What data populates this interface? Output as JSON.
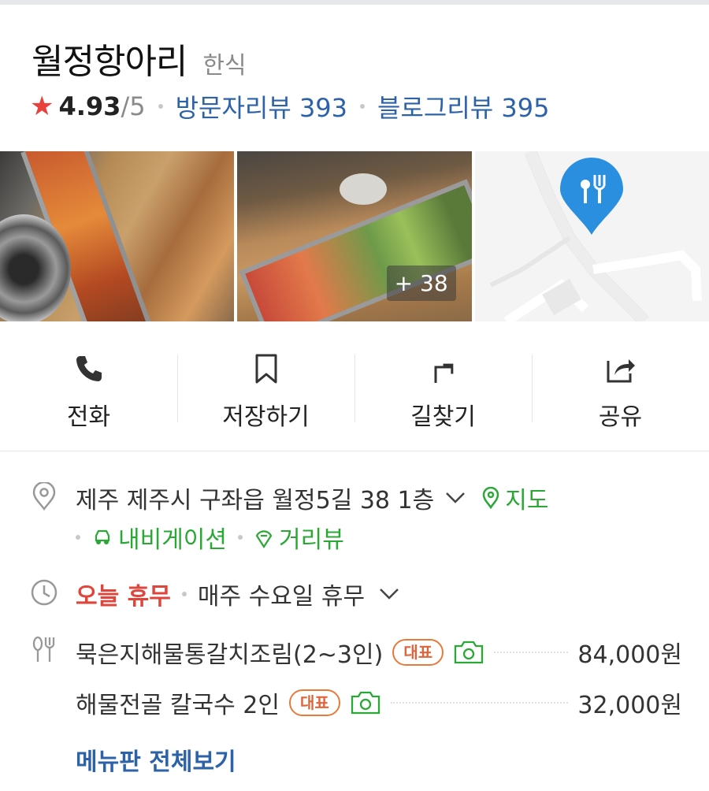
{
  "place": {
    "name": "월정항아리",
    "category": "한식"
  },
  "rating": {
    "score": "4.93",
    "max": "/5",
    "visitor_reviews": "방문자리뷰 393",
    "blog_reviews": "블로그리뷰 395"
  },
  "gallery": {
    "more_count": "+ 38"
  },
  "actions": [
    {
      "label": "전화",
      "icon": "phone-icon"
    },
    {
      "label": "저장하기",
      "icon": "bookmark-icon"
    },
    {
      "label": "길찾기",
      "icon": "directions-icon"
    },
    {
      "label": "공유",
      "icon": "share-icon"
    }
  ],
  "address": {
    "text": "제주 제주시 구좌읍 월정5길 38 1층",
    "map_link": "지도",
    "navigation_link": "내비게이션",
    "street_view_link": "거리뷰"
  },
  "hours": {
    "status": "오늘 휴무",
    "detail": "매주 수요일 휴무"
  },
  "menu": {
    "badge": "대표",
    "items": [
      {
        "name": "묵은지해물통갈치조림(2~3인)",
        "price": "84,000원"
      },
      {
        "name": "해물전골 칼국수 2인",
        "price": "32,000원"
      }
    ],
    "view_all": "메뉴판 전체보기"
  },
  "colors": {
    "accent_blue": "#2d62a8",
    "green": "#2aa835",
    "star_red": "#e8403a",
    "closed_red": "#e0443a",
    "badge_orange": "#e77a3a",
    "map_pin": "#2b8fe0"
  }
}
